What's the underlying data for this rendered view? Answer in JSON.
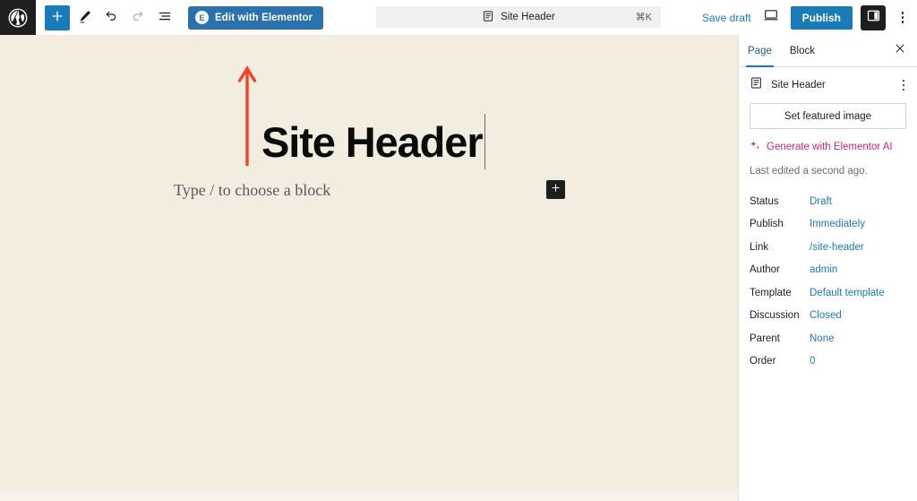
{
  "header": {
    "wp_logo_icon": "wordpress-logo-icon",
    "tools": [
      {
        "name": "block-inserter-toggle",
        "icon": "plus-icon",
        "state": "active"
      },
      {
        "name": "tools-pencil",
        "icon": "pencil-icon",
        "state": "default"
      },
      {
        "name": "undo-button",
        "icon": "undo-icon",
        "state": "default"
      },
      {
        "name": "redo-button",
        "icon": "redo-icon",
        "state": "disabled"
      },
      {
        "name": "list-view-button",
        "icon": "list-view-icon",
        "state": "default"
      }
    ],
    "elementor_button": {
      "label": "Edit with Elementor",
      "badge": "E"
    },
    "command_bar": {
      "title": "Site Header",
      "shortcut": "⌘K",
      "icon": "page-icon"
    },
    "save_draft_label": "Save draft",
    "preview_icon": "desktop-preview-icon",
    "publish_label": "Publish",
    "settings_toggle_icon": "sidebar-panel-icon",
    "more_menu_icon": "vertical-ellipsis-icon"
  },
  "canvas": {
    "post_title": "Site Header",
    "block_placeholder": "Type / to choose a block",
    "inserter_icon": "plus-icon",
    "annotation": {
      "type": "arrow-up",
      "color": "#f2402f"
    },
    "background_color": "#f3eddf"
  },
  "sidebar": {
    "tabs": [
      {
        "label": "Page",
        "active": true
      },
      {
        "label": "Block",
        "active": false
      }
    ],
    "close_icon": "close-icon",
    "post_card": {
      "title": "Site Header",
      "icon": "page-icon",
      "more_icon": "vertical-ellipsis-icon"
    },
    "featured_image_label": "Set featured image",
    "ai_label": "Generate with Elementor AI",
    "ai_icon": "sparkle-icon",
    "ai_color": "#d6217f",
    "last_edited": "Last edited a second ago.",
    "meta": [
      {
        "key": "Status",
        "value": "Draft"
      },
      {
        "key": "Publish",
        "value": "Immediately"
      },
      {
        "key": "Link",
        "value": "/site-header"
      },
      {
        "key": "Author",
        "value": "admin"
      },
      {
        "key": "Template",
        "value": "Default template"
      },
      {
        "key": "Discussion",
        "value": "Closed"
      },
      {
        "key": "Parent",
        "value": "None"
      },
      {
        "key": "Order",
        "value": "0"
      }
    ]
  },
  "colors": {
    "accent_blue": "#1a7bb9",
    "dark": "#1e1e1e",
    "canvas": "#f3eddf",
    "annotation_red": "#f2402f"
  }
}
